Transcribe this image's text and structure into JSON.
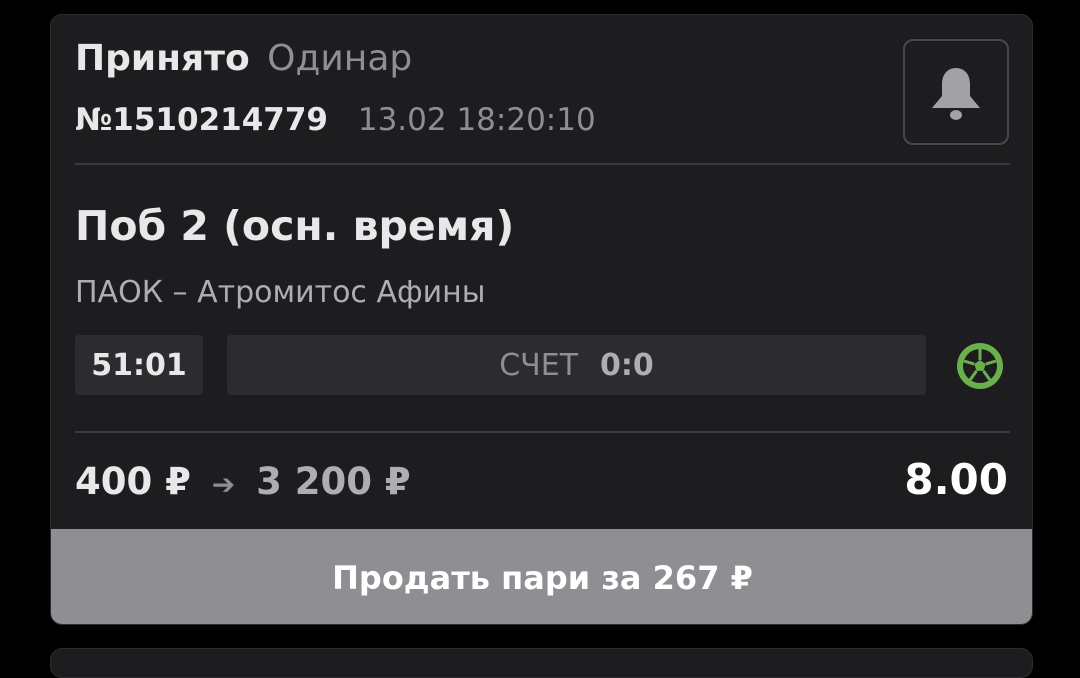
{
  "bet": {
    "status": "Принято",
    "type": "Одинар",
    "number": "№1510214779",
    "datetime": "13.02 18:20:10",
    "outcome": "Поб 2 (осн. время)",
    "match": "ПАОК – Атромитос Афины",
    "match_time": "51:01",
    "score_label": "СЧЕТ",
    "score_value": "0:0",
    "stake": "400 ₽",
    "payout": "3 200 ₽",
    "odds": "8.00",
    "sell_label": "Продать пари за 267 ₽"
  },
  "icons": {
    "notification": "bell-icon",
    "sport": "football-icon",
    "arrow": "arrow-right-icon"
  },
  "colors": {
    "card_background": "#1d1d1f",
    "primary_text": "#e8e8ea",
    "secondary_text": "#8e8e93",
    "sell_button": "#8e8e93",
    "sport_icon": "#6ab04c"
  }
}
